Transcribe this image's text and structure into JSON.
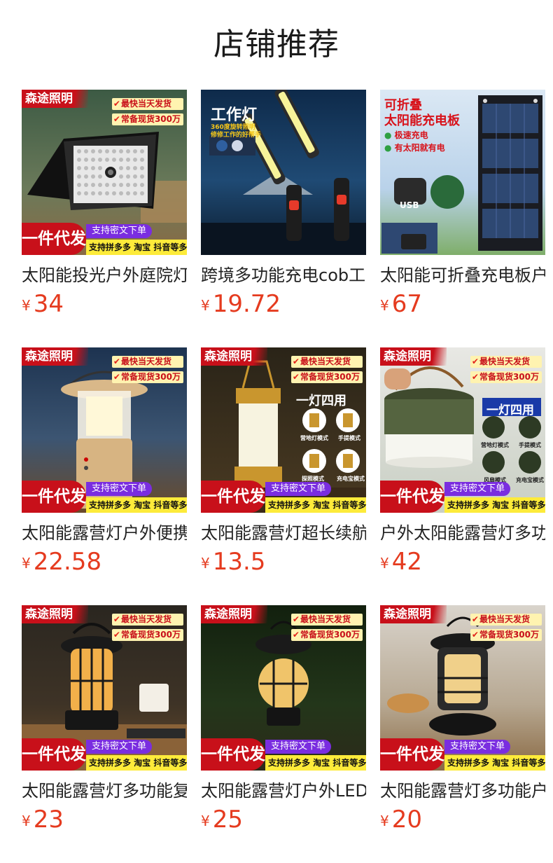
{
  "page": {
    "title": "店铺推荐"
  },
  "common": {
    "brand": "森途照明",
    "tag1": "最快当天发货",
    "tag2": "常备现货300万",
    "yijian": "一件代发",
    "mima": "支持密文下单",
    "platforms": "支持拼多多 淘宝 抖音等多平台",
    "currency": "¥",
    "check": "✔"
  },
  "products": [
    {
      "name": "太阳能投光户外庭院灯",
      "price": "34",
      "badge_style": "standard",
      "scene": "panel"
    },
    {
      "name": "跨境多功能充电cob工作灯",
      "price": "19.72",
      "badge_style": "worklight",
      "scene": "worklight",
      "overlay": {
        "title": "工作灯",
        "subtitle1": "360度旋转照明",
        "subtitle2": "修修工作的好帮手"
      }
    },
    {
      "name": "太阳能可折叠充电板户外",
      "price": "67",
      "badge_style": "solar",
      "scene": "solar",
      "overlay": {
        "title1": "可折叠",
        "title2": "太阳能充电板",
        "feat1": "极速充电",
        "feat2": "有太阳就有电",
        "usb": "USB"
      }
    },
    {
      "name": "太阳能露营灯户外便携",
      "price": "22.58",
      "badge_style": "standard",
      "scene": "lantern-wood"
    },
    {
      "name": "太阳能露营灯超长续航",
      "price": "13.5",
      "badge_style": "standard",
      "scene": "lantern-gold",
      "overlay": {
        "big": "一灯四用",
        "m1": "营地灯模式",
        "m2": "手提模式",
        "m3": "探照模式",
        "m4": "充电宝模式"
      }
    },
    {
      "name": "户外太阳能露营灯多功能",
      "price": "42",
      "badge_style": "standard",
      "scene": "fan",
      "overlay": {
        "big": "一灯四用",
        "m1": "营地灯模式",
        "m2": "手提模式",
        "m3": "风扇模式",
        "m4": "充电宝模式"
      }
    },
    {
      "name": "太阳能露营灯多功能复古",
      "price": "23",
      "badge_style": "standard",
      "scene": "vintage-table"
    },
    {
      "name": "太阳能露营灯户外LED",
      "price": "25",
      "badge_style": "standard",
      "scene": "vintage-green"
    },
    {
      "name": "太阳能露营灯多功能户外",
      "price": "20",
      "badge_style": "standard",
      "scene": "vintage-dark"
    }
  ]
}
